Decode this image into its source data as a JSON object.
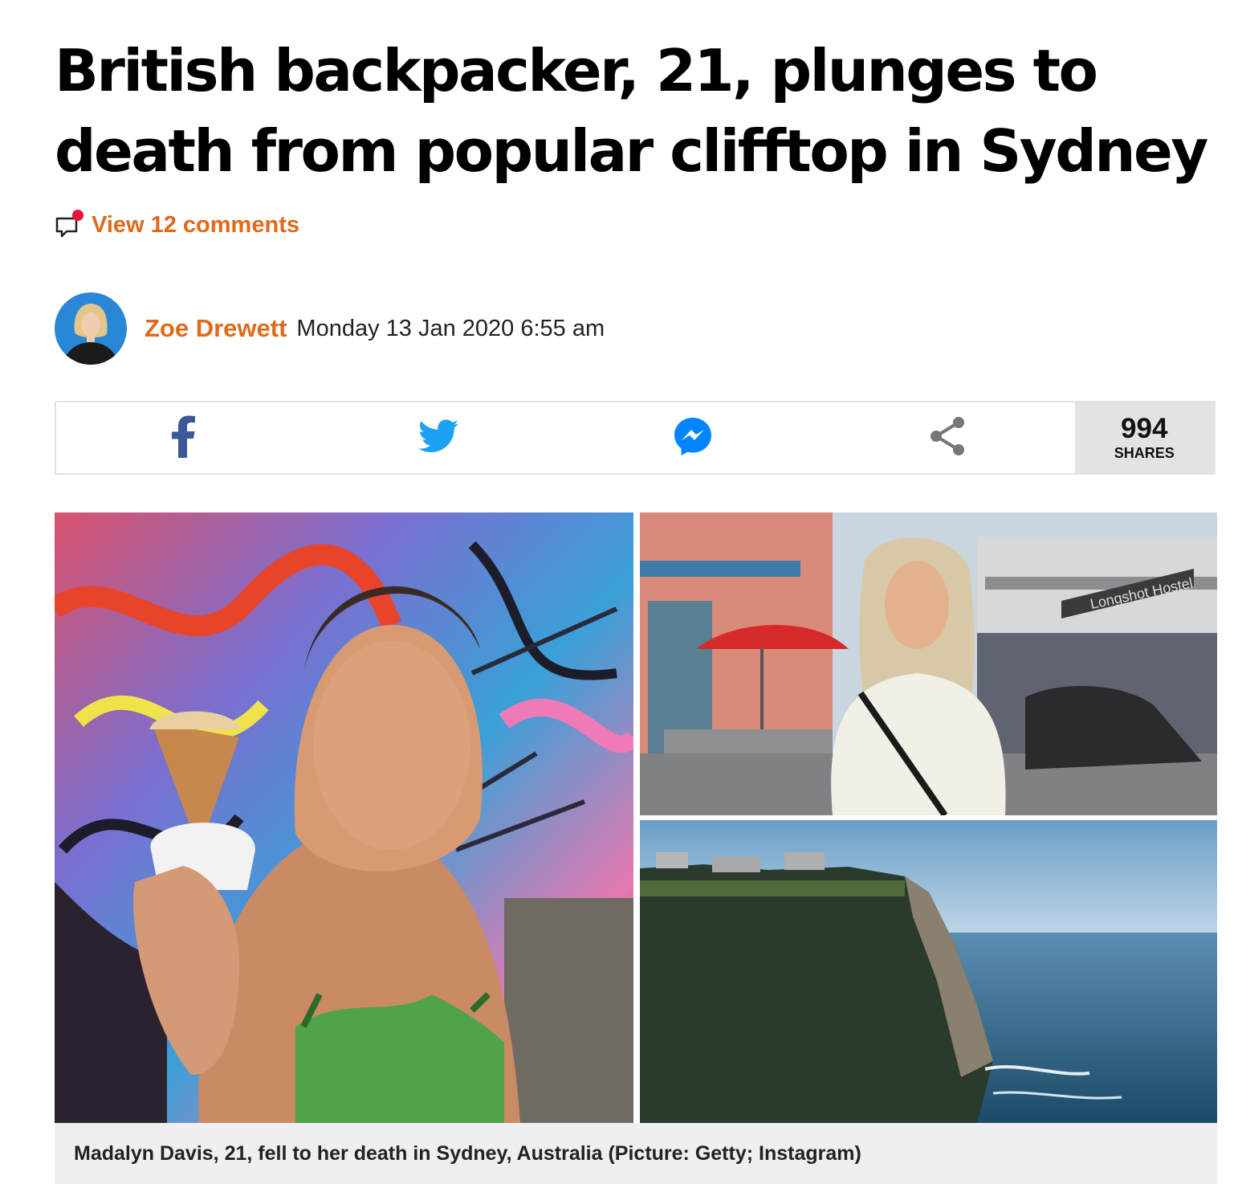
{
  "article": {
    "headline": "British backpacker, 21, plunges to death from popular clifftop in Sydney",
    "comments_link": "View 12 comments",
    "author": "Zoe Drewett",
    "date": "Monday 13 Jan 2020 6:55 am"
  },
  "share": {
    "buttons": [
      {
        "name": "facebook",
        "icon": "facebook-icon",
        "color": "#3b5998"
      },
      {
        "name": "twitter",
        "icon": "twitter-icon",
        "color": "#1da1f2"
      },
      {
        "name": "messenger",
        "icon": "messenger-icon",
        "color": "#0084ff"
      },
      {
        "name": "share",
        "icon": "share-icon",
        "color": "#777777"
      }
    ],
    "count": "994",
    "count_label": "SHARES"
  },
  "image": {
    "caption": "Madalyn Davis, 21, fell to her death in Sydney, Australia (Picture: Getty; Instagram)",
    "hostel_sign": "Longshot Hostel"
  },
  "colors": {
    "accent": "#e0691a",
    "notification_dot": "#e8173a"
  }
}
